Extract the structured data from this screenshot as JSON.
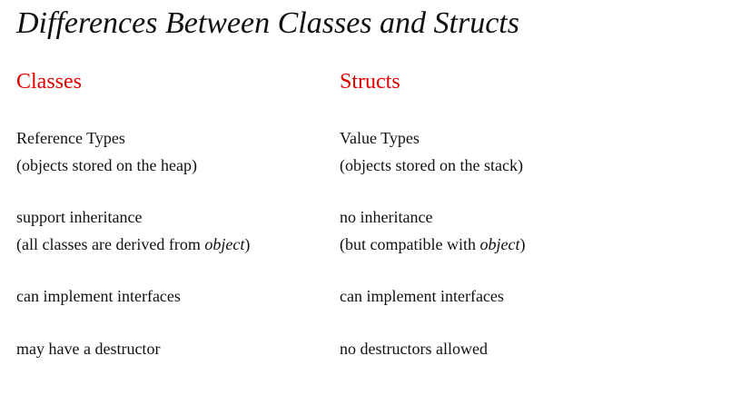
{
  "title": "Differences Between Classes and Structs",
  "colors": {
    "heading": "#e00000",
    "text": "#111111",
    "background": "#ffffff"
  },
  "classes": {
    "heading": "Classes",
    "rows": [
      {
        "line1": "Reference Types",
        "line2": "(objects stored on the heap)"
      },
      {
        "line1": "support inheritance",
        "line2_before": "(all classes are derived from ",
        "line2_em": "object",
        "line2_after": ")"
      },
      {
        "line1": "can implement interfaces"
      },
      {
        "line1": "may have a destructor"
      }
    ]
  },
  "structs": {
    "heading": "Structs",
    "rows": [
      {
        "line1": "Value Types",
        "line2": "(objects stored on the stack)"
      },
      {
        "line1": "no inheritance",
        "line2_before": "(but compatible with ",
        "line2_em": "object",
        "line2_after": ")"
      },
      {
        "line1": "can implement interfaces"
      },
      {
        "line1": "no destructors allowed"
      }
    ]
  }
}
